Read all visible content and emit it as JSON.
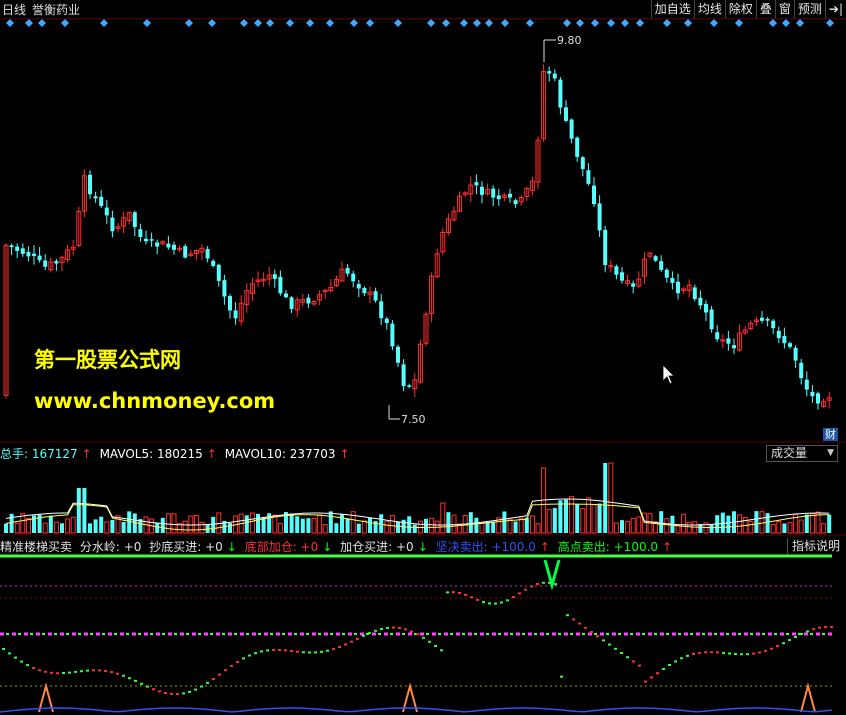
{
  "window": {
    "period": "日线",
    "stock_name": "誉衡药业"
  },
  "toolbar": [
    "加自选",
    "均线",
    "除权",
    "叠",
    "窗",
    "预测",
    "➔|"
  ],
  "price": {
    "high_label": "9.80",
    "low_label": "7.50",
    "cai_label": "财",
    "colors": {
      "up": "#ff3030",
      "down": "#54ffff",
      "diamond": "#3fa9ff"
    }
  },
  "volume": {
    "legend": [
      {
        "text": "总手: 167127",
        "color": "#54ffff"
      },
      {
        "text": "↑",
        "color": "#ff3030"
      },
      {
        "text": "MAVOL5: 180215",
        "color": "#ffffff"
      },
      {
        "text": "↑",
        "color": "#ff3030"
      },
      {
        "text": "MAVOL10: 237703",
        "color": "#ffffff"
      },
      {
        "text": "↑",
        "color": "#ff3030"
      }
    ],
    "selector": "成交量"
  },
  "indicator": {
    "legend": [
      {
        "text": "精准楼梯买卖",
        "color": "#e0e0e0"
      },
      {
        "text": "分水岭: +0",
        "color": "#e0e0e0"
      },
      {
        "text": "抄底买进: +0",
        "color": "#e0e0e0"
      },
      {
        "text": "↓",
        "color": "#00ff00"
      },
      {
        "text": "底部加仓: +0",
        "color": "#ff3030"
      },
      {
        "text": "↓",
        "color": "#00ff00"
      },
      {
        "text": "加仓买进: +0",
        "color": "#e0e0e0"
      },
      {
        "text": "↓",
        "color": "#00ff00"
      },
      {
        "text": "坚决卖出: +100.0",
        "color": "#3050ff"
      },
      {
        "text": "↑",
        "color": "#ff3030"
      },
      {
        "text": "高点卖出: +100.0",
        "color": "#00ff00"
      },
      {
        "text": "↑",
        "color": "#ff3030"
      }
    ],
    "help": "指标说明"
  },
  "watermark": {
    "line1": "第一股票公式网",
    "line2": "www.chnmoney.com"
  }
}
